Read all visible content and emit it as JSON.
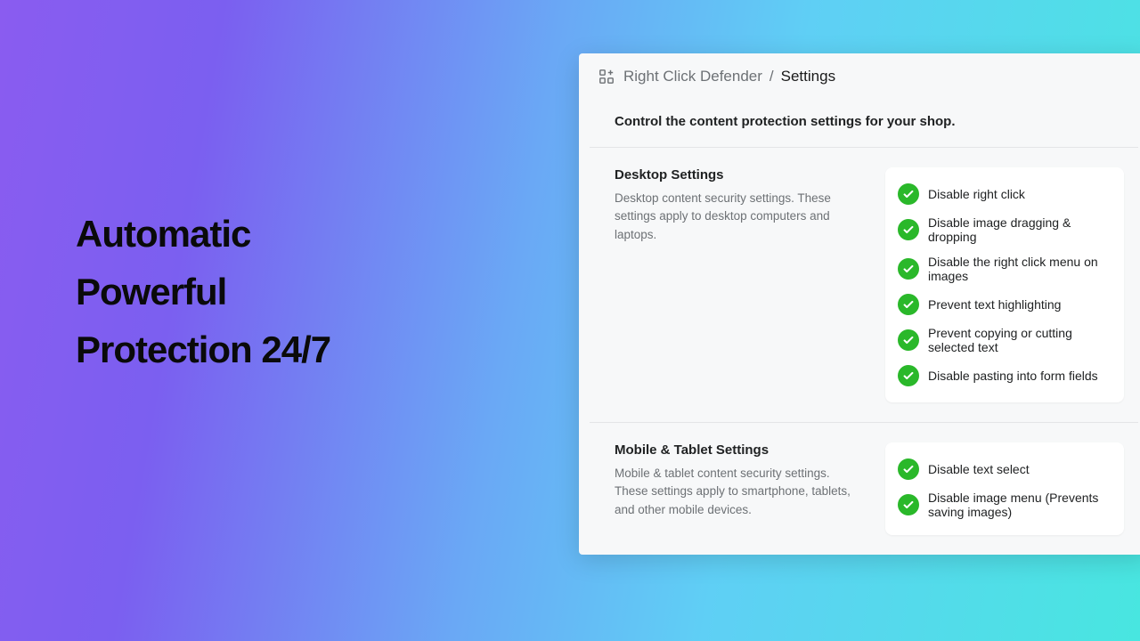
{
  "hero": {
    "line1": "Automatic",
    "line2": "Powerful",
    "line3": "Protection 24/7"
  },
  "breadcrumb": {
    "app": "Right Click Defender",
    "separator": "/",
    "current": "Settings"
  },
  "intro": "Control the content protection settings for your shop.",
  "sections": [
    {
      "title": "Desktop Settings",
      "desc": "Desktop content security settings. These settings apply to desktop computers and laptops.",
      "options": [
        "Disable right click",
        "Disable image dragging & dropping",
        "Disable the right click menu on images",
        "Prevent text highlighting",
        "Prevent copying or cutting selected text",
        "Disable pasting into form fields"
      ]
    },
    {
      "title": "Mobile & Tablet Settings",
      "desc": "Mobile & tablet content security settings. These settings apply to smartphone, tablets, and other mobile devices.",
      "options": [
        "Disable text select",
        "Disable image menu (Prevents saving images)"
      ]
    }
  ]
}
